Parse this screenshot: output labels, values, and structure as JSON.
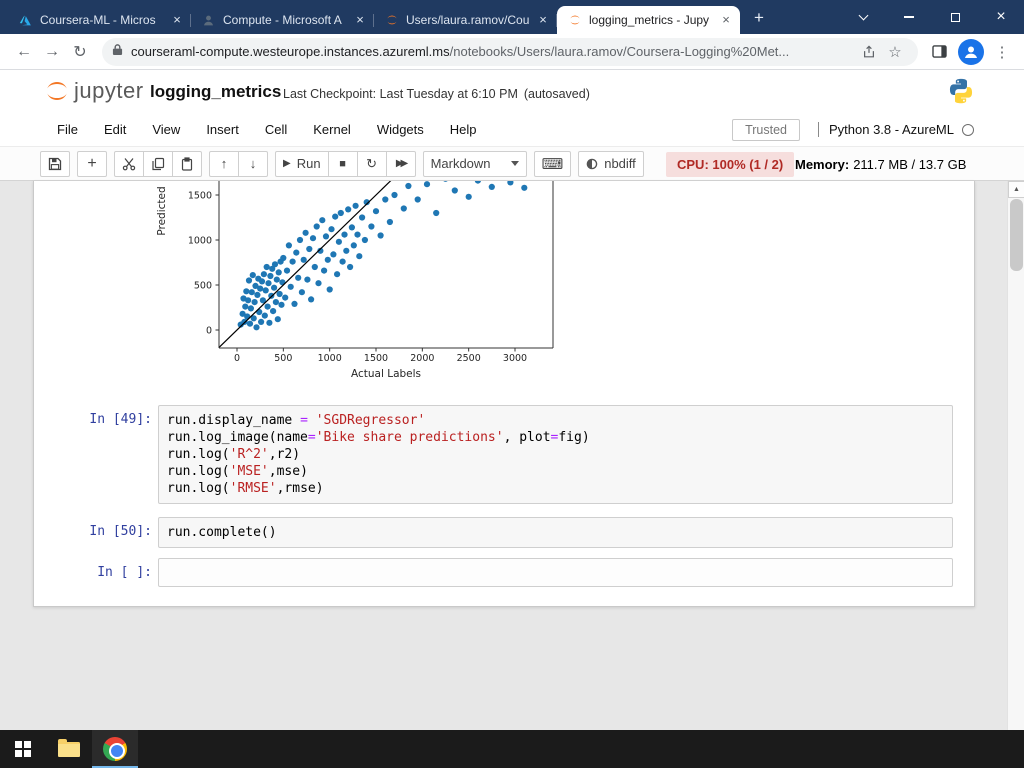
{
  "browser": {
    "tabs": [
      {
        "title": "Coursera-ML - Micros",
        "icon": "azure-icon",
        "active": false
      },
      {
        "title": "Compute - Microsoft A",
        "icon": "azure-compute-icon",
        "active": false
      },
      {
        "title": "Users/laura.ramov/Cou",
        "icon": "jupyter-icon",
        "active": false
      },
      {
        "title": "logging_metrics - Jupy",
        "icon": "jupyter-icon",
        "active": true
      }
    ],
    "url_domain": "courseraml-compute.westeurope.instances.azureml.ms",
    "url_path": "/notebooks/Users/laura.ramov/Coursera-Logging%20Met..."
  },
  "icons": {
    "back": "←",
    "forward": "→",
    "reload": "↻",
    "star": "☆",
    "kebab": "⋮",
    "up": "↑",
    "down": "↓",
    "run": "▶",
    "stop": "■",
    "restart": "↻",
    "ff": "▶▶",
    "keyboard": "⌨",
    "close": "×",
    "newtab": "+",
    "plus": "+",
    "scroll_up": "▲"
  },
  "jupyter": {
    "logo_text": "jupyter",
    "title": "logging_metrics",
    "checkpoint": "Last Checkpoint: Last Tuesday at 6:10 PM",
    "autosaved": "(autosaved)",
    "menu": [
      "File",
      "Edit",
      "View",
      "Insert",
      "Cell",
      "Kernel",
      "Widgets",
      "Help"
    ],
    "trusted_label": "Trusted",
    "kernel_name": "Python 3.8 - AzureML",
    "toolbar": {
      "run_label": "Run",
      "cell_type": "Markdown",
      "nbdiff_label": "nbdiff",
      "cpu": "CPU: 100% (1 / 2)",
      "memory_label": "Memory:",
      "memory_value": "211.7 MB / 13.7 GB"
    }
  },
  "cells": [
    {
      "prompt": "In [49]:",
      "lines": [
        [
          {
            "t": "run.display_name "
          },
          {
            "t": "=",
            "c": "op"
          },
          {
            "t": " "
          },
          {
            "t": "'SGDRegressor'",
            "c": "str"
          }
        ],
        [
          {
            "t": "run.log_image(name"
          },
          {
            "t": "=",
            "c": "op"
          },
          {
            "t": "'Bike share predictions'",
            "c": "str"
          },
          {
            "t": ", plot"
          },
          {
            "t": "=",
            "c": "op"
          },
          {
            "t": "fig)"
          }
        ],
        [
          {
            "t": "run.log("
          },
          {
            "t": "'R^2'",
            "c": "str"
          },
          {
            "t": ",r2)"
          }
        ],
        [
          {
            "t": "run.log("
          },
          {
            "t": "'MSE'",
            "c": "str"
          },
          {
            "t": ",mse)"
          }
        ],
        [
          {
            "t": "run.log("
          },
          {
            "t": "'RMSE'",
            "c": "str"
          },
          {
            "t": ",rmse)"
          }
        ]
      ]
    },
    {
      "prompt": "In [50]:",
      "lines": [
        [
          {
            "t": "run.complete()"
          }
        ]
      ]
    },
    {
      "prompt": "In [ ]:",
      "lines": []
    }
  ],
  "chart_data": {
    "type": "scatter",
    "xlabel": "Actual Labels",
    "ylabel": "Predicted",
    "x_ticks": [
      0,
      500,
      1000,
      1500,
      2000,
      2500,
      3000
    ],
    "y_ticks": [
      0,
      500,
      1000,
      1500
    ],
    "x_visible_range": [
      -200,
      3420
    ],
    "y_visible_range": [
      -200,
      1660
    ],
    "identity_line": {
      "x": [
        -200,
        1660
      ],
      "y": [
        -200,
        1660
      ]
    },
    "series": [
      {
        "name": "predictions",
        "color": "#1f77b4",
        "points": [
          [
            40,
            60
          ],
          [
            60,
            180
          ],
          [
            70,
            350
          ],
          [
            80,
            90
          ],
          [
            90,
            260
          ],
          [
            100,
            430
          ],
          [
            110,
            150
          ],
          [
            120,
            330
          ],
          [
            130,
            550
          ],
          [
            140,
            70
          ],
          [
            150,
            240
          ],
          [
            160,
            420
          ],
          [
            170,
            610
          ],
          [
            180,
            130
          ],
          [
            190,
            310
          ],
          [
            200,
            490
          ],
          [
            210,
            30
          ],
          [
            220,
            390
          ],
          [
            230,
            570
          ],
          [
            240,
            200
          ],
          [
            250,
            460
          ],
          [
            260,
            90
          ],
          [
            270,
            540
          ],
          [
            280,
            330
          ],
          [
            290,
            620
          ],
          [
            300,
            160
          ],
          [
            310,
            440
          ],
          [
            320,
            700
          ],
          [
            330,
            260
          ],
          [
            340,
            520
          ],
          [
            350,
            80
          ],
          [
            360,
            600
          ],
          [
            370,
            380
          ],
          [
            380,
            680
          ],
          [
            390,
            210
          ],
          [
            400,
            470
          ],
          [
            410,
            730
          ],
          [
            420,
            310
          ],
          [
            430,
            560
          ],
          [
            440,
            120
          ],
          [
            450,
            640
          ],
          [
            460,
            400
          ],
          [
            470,
            760
          ],
          [
            480,
            280
          ],
          [
            490,
            530
          ],
          [
            500,
            800
          ],
          [
            520,
            360
          ],
          [
            540,
            660
          ],
          [
            560,
            940
          ],
          [
            580,
            480
          ],
          [
            600,
            760
          ],
          [
            620,
            290
          ],
          [
            640,
            860
          ],
          [
            660,
            580
          ],
          [
            680,
            1000
          ],
          [
            700,
            420
          ],
          [
            720,
            780
          ],
          [
            740,
            1080
          ],
          [
            760,
            560
          ],
          [
            780,
            900
          ],
          [
            800,
            340
          ],
          [
            820,
            1020
          ],
          [
            840,
            700
          ],
          [
            860,
            1150
          ],
          [
            880,
            520
          ],
          [
            900,
            880
          ],
          [
            920,
            1220
          ],
          [
            940,
            660
          ],
          [
            960,
            1040
          ],
          [
            980,
            780
          ],
          [
            1000,
            450
          ],
          [
            1020,
            1120
          ],
          [
            1040,
            840
          ],
          [
            1060,
            1260
          ],
          [
            1080,
            620
          ],
          [
            1100,
            980
          ],
          [
            1120,
            1300
          ],
          [
            1140,
            760
          ],
          [
            1160,
            1060
          ],
          [
            1180,
            880
          ],
          [
            1200,
            1340
          ],
          [
            1220,
            700
          ],
          [
            1240,
            1140
          ],
          [
            1260,
            940
          ],
          [
            1280,
            1380
          ],
          [
            1300,
            1060
          ],
          [
            1320,
            820
          ],
          [
            1350,
            1250
          ],
          [
            1380,
            1000
          ],
          [
            1400,
            1420
          ],
          [
            1450,
            1150
          ],
          [
            1500,
            1320
          ],
          [
            1550,
            1050
          ],
          [
            1600,
            1450
          ],
          [
            1650,
            1200
          ],
          [
            1700,
            1500
          ],
          [
            1800,
            1350
          ],
          [
            1850,
            1600
          ],
          [
            1950,
            1450
          ],
          [
            2050,
            1620
          ],
          [
            2150,
            1300
          ],
          [
            2250,
            1680
          ],
          [
            2350,
            1550
          ],
          [
            2500,
            1480
          ],
          [
            2600,
            1660
          ],
          [
            2750,
            1590
          ],
          [
            2950,
            1640
          ],
          [
            3100,
            1580
          ]
        ]
      }
    ]
  }
}
